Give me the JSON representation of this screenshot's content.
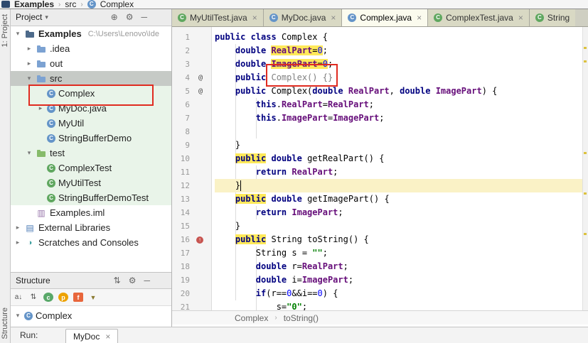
{
  "navbar": {
    "items": [
      {
        "label": "Examples",
        "icon": "project"
      },
      {
        "label": "src",
        "icon": "none"
      },
      {
        "label": "Complex",
        "icon": "class"
      }
    ]
  },
  "stripe": {
    "top": "1: Project",
    "bottom": "Structure"
  },
  "project_panel": {
    "header": {
      "title": "Project",
      "icons": [
        {
          "name": "locate",
          "glyph": "⊕"
        },
        {
          "name": "settings",
          "glyph": "⚙"
        },
        {
          "name": "hide",
          "glyph": "─"
        }
      ]
    },
    "tree": [
      {
        "label": "Examples",
        "suffix": "C:\\Users\\Lenovo\\Ide",
        "icon": "project-folder",
        "chevron": "expanded",
        "indent": 0,
        "bold": true,
        "bg": "none"
      },
      {
        "label": ".idea",
        "icon": "folder",
        "chevron": "collapsed",
        "indent": 1,
        "bg": "none"
      },
      {
        "label": "out",
        "icon": "folder",
        "chevron": "collapsed",
        "indent": 1,
        "bg": "none"
      },
      {
        "label": "src",
        "icon": "folder",
        "chevron": "expanded",
        "indent": 1,
        "bg": "selected"
      },
      {
        "label": "Complex",
        "icon": "class",
        "chevron": "none",
        "indent": 2,
        "bg": "green",
        "annotated": true
      },
      {
        "label": "MyDoc.java",
        "icon": "class",
        "chevron": "collapsed",
        "indent": 2,
        "bg": "green"
      },
      {
        "label": "MyUtil",
        "icon": "class",
        "chevron": "none",
        "indent": 2,
        "bg": "green"
      },
      {
        "label": "StringBufferDemo",
        "icon": "class",
        "chevron": "none",
        "indent": 2,
        "bg": "green"
      },
      {
        "label": "test",
        "icon": "folder-test",
        "chevron": "expanded",
        "indent": 1,
        "bg": "green"
      },
      {
        "label": "ComplexTest",
        "icon": "class-test",
        "chevron": "none",
        "indent": 2,
        "bg": "green"
      },
      {
        "label": "MyUtilTest",
        "icon": "class-test",
        "chevron": "none",
        "indent": 2,
        "bg": "green"
      },
      {
        "label": "StringBufferDemoTest",
        "icon": "class-test",
        "chevron": "none",
        "indent": 2,
        "bg": "green"
      },
      {
        "label": "Examples.iml",
        "icon": "module-file",
        "chevron": "none",
        "indent": 1,
        "bg": "none"
      },
      {
        "label": "External Libraries",
        "icon": "library",
        "chevron": "collapsed",
        "indent": 0,
        "bg": "none"
      },
      {
        "label": "Scratches and Consoles",
        "icon": "scratch",
        "chevron": "collapsed",
        "indent": 0,
        "bg": "none"
      }
    ]
  },
  "structure_panel": {
    "title": "Structure",
    "header_icons": [
      {
        "name": "sort",
        "glyph": "⇅"
      },
      {
        "name": "settings",
        "glyph": "⚙"
      },
      {
        "name": "hide",
        "glyph": "─"
      }
    ],
    "toolbar": [
      {
        "name": "sort-alpha",
        "glyph": "a↓",
        "badge": "plain"
      },
      {
        "name": "sort-visibility",
        "glyph": "⇅",
        "badge": "plain"
      },
      {
        "name": "show-classes",
        "glyph": "c",
        "badge": "green"
      },
      {
        "name": "show-properties",
        "glyph": "p",
        "badge": "yellow"
      },
      {
        "name": "show-fields",
        "glyph": "f",
        "badge": "orange"
      },
      {
        "name": "filter",
        "glyph": "▼",
        "badge": "plain"
      }
    ],
    "content": [
      {
        "label": "Complex",
        "icon": "class",
        "chevron": "expanded"
      }
    ]
  },
  "editor": {
    "close_glyph": "×",
    "tabs": [
      {
        "label": "MyUtilTest.java",
        "icon": "class-test",
        "active": false,
        "close": true
      },
      {
        "label": "MyDoc.java",
        "icon": "class",
        "active": false,
        "close": true
      },
      {
        "label": "Complex.java",
        "icon": "class",
        "active": true,
        "close": true
      },
      {
        "label": "ComplexTest.java",
        "icon": "class-test",
        "active": false,
        "close": true
      },
      {
        "label": "String",
        "icon": "class-test",
        "active": false,
        "close": false,
        "clipped": true
      }
    ],
    "breadcrumbs": [
      "Complex",
      "toString()"
    ],
    "lines": [
      {
        "n": 1,
        "tokens": [
          {
            "t": "public ",
            "c": "k"
          },
          {
            "t": "class ",
            "c": "k"
          },
          {
            "t": "Complex {",
            "c": "p"
          }
        ]
      },
      {
        "n": 2,
        "tokens": [
          {
            "t": "    ",
            "c": "p"
          },
          {
            "t": "double ",
            "c": "k"
          },
          {
            "t": "RealPart",
            "c": "f",
            "h": true
          },
          {
            "t": "=",
            "c": "p",
            "h": true
          },
          {
            "t": "0",
            "c": "n",
            "h": true
          },
          {
            "t": ";",
            "c": "p"
          }
        ]
      },
      {
        "n": 3,
        "tokens": [
          {
            "t": "    ",
            "c": "p"
          },
          {
            "t": "double ",
            "c": "k"
          },
          {
            "t": "ImagePart",
            "c": "f",
            "h": true
          },
          {
            "t": "=",
            "c": "p",
            "h": true
          },
          {
            "t": "0",
            "c": "n",
            "h": true
          },
          {
            "t": ";",
            "c": "p"
          }
        ]
      },
      {
        "n": 4,
        "gutter": "at",
        "tokens": [
          {
            "t": "    ",
            "c": "p"
          },
          {
            "t": "public ",
            "c": "k"
          },
          {
            "t": "Complex() {}",
            "c": "g"
          }
        ]
      },
      {
        "n": 5,
        "gutter": "at",
        "tokens": [
          {
            "t": "    ",
            "c": "p"
          },
          {
            "t": "public ",
            "c": "k"
          },
          {
            "t": "Complex(",
            "c": "p"
          },
          {
            "t": "double ",
            "c": "k"
          },
          {
            "t": "RealPart",
            "c": "f"
          },
          {
            "t": ", ",
            "c": "p"
          },
          {
            "t": "double ",
            "c": "k"
          },
          {
            "t": "ImagePart",
            "c": "f"
          },
          {
            "t": ") {",
            "c": "p"
          }
        ]
      },
      {
        "n": 6,
        "tokens": [
          {
            "t": "        ",
            "c": "p"
          },
          {
            "t": "this",
            "c": "k"
          },
          {
            "t": ".",
            "c": "p"
          },
          {
            "t": "RealPart",
            "c": "f"
          },
          {
            "t": "=",
            "c": "p"
          },
          {
            "t": "RealPart",
            "c": "f"
          },
          {
            "t": ";",
            "c": "p"
          }
        ]
      },
      {
        "n": 7,
        "tokens": [
          {
            "t": "        ",
            "c": "p"
          },
          {
            "t": "this",
            "c": "k"
          },
          {
            "t": ".",
            "c": "p"
          },
          {
            "t": "ImagePart",
            "c": "f"
          },
          {
            "t": "=",
            "c": "p"
          },
          {
            "t": "ImagePart",
            "c": "f"
          },
          {
            "t": ";",
            "c": "p"
          }
        ]
      },
      {
        "n": 8,
        "tokens": []
      },
      {
        "n": 9,
        "tokens": [
          {
            "t": "    }",
            "c": "p"
          }
        ]
      },
      {
        "n": 10,
        "tokens": [
          {
            "t": "    ",
            "c": "p"
          },
          {
            "t": "public",
            "c": "k",
            "h": true
          },
          {
            "t": " ",
            "c": "p"
          },
          {
            "t": "double ",
            "c": "k"
          },
          {
            "t": "getRealPart() {",
            "c": "p"
          }
        ]
      },
      {
        "n": 11,
        "tokens": [
          {
            "t": "        ",
            "c": "p"
          },
          {
            "t": "return ",
            "c": "k"
          },
          {
            "t": "RealPart",
            "c": "f"
          },
          {
            "t": ";",
            "c": "p"
          }
        ]
      },
      {
        "n": 12,
        "caret": true,
        "tokens": [
          {
            "t": "    }",
            "c": "p"
          }
        ]
      },
      {
        "n": 13,
        "tokens": [
          {
            "t": "    ",
            "c": "p"
          },
          {
            "t": "public",
            "c": "k",
            "h": true
          },
          {
            "t": " ",
            "c": "p"
          },
          {
            "t": "double ",
            "c": "k"
          },
          {
            "t": "getImagePart() {",
            "c": "p"
          }
        ]
      },
      {
        "n": 14,
        "tokens": [
          {
            "t": "        ",
            "c": "p"
          },
          {
            "t": "return ",
            "c": "k"
          },
          {
            "t": "ImagePart",
            "c": "f"
          },
          {
            "t": ";",
            "c": "p"
          }
        ]
      },
      {
        "n": 15,
        "tokens": [
          {
            "t": "    }",
            "c": "p"
          }
        ]
      },
      {
        "n": 16,
        "gutter": "override",
        "tokens": [
          {
            "t": "    ",
            "c": "p"
          },
          {
            "t": "public",
            "c": "k",
            "h": true
          },
          {
            "t": " ",
            "c": "p"
          },
          {
            "t": "String toString() {",
            "c": "p"
          }
        ]
      },
      {
        "n": 17,
        "tokens": [
          {
            "t": "        ",
            "c": "p"
          },
          {
            "t": "String s = ",
            "c": "p"
          },
          {
            "t": "\"\"",
            "c": "s"
          },
          {
            "t": ";",
            "c": "p"
          }
        ]
      },
      {
        "n": 18,
        "tokens": [
          {
            "t": "        ",
            "c": "p"
          },
          {
            "t": "double ",
            "c": "k"
          },
          {
            "t": "r=",
            "c": "p"
          },
          {
            "t": "RealPart",
            "c": "f"
          },
          {
            "t": ";",
            "c": "p"
          }
        ]
      },
      {
        "n": 19,
        "tokens": [
          {
            "t": "        ",
            "c": "p"
          },
          {
            "t": "double ",
            "c": "k"
          },
          {
            "t": "i=",
            "c": "p"
          },
          {
            "t": "ImagePart",
            "c": "f"
          },
          {
            "t": ";",
            "c": "p"
          }
        ]
      },
      {
        "n": 20,
        "tokens": [
          {
            "t": "        ",
            "c": "p"
          },
          {
            "t": "if",
            "c": "k"
          },
          {
            "t": "(r==",
            "c": "p"
          },
          {
            "t": "0",
            "c": "n"
          },
          {
            "t": "&&i==",
            "c": "p"
          },
          {
            "t": "0",
            "c": "n"
          },
          {
            "t": ") {",
            "c": "p"
          }
        ]
      },
      {
        "n": 21,
        "tokens": [
          {
            "t": "            ",
            "c": "p"
          },
          {
            "t": "s=",
            "c": "p"
          },
          {
            "t": "\"0\"",
            "c": "s"
          },
          {
            "t": ";",
            "c": "p"
          }
        ]
      }
    ]
  },
  "run_bar": {
    "label": "Run:",
    "tab": "MyDoc",
    "close": "×"
  }
}
